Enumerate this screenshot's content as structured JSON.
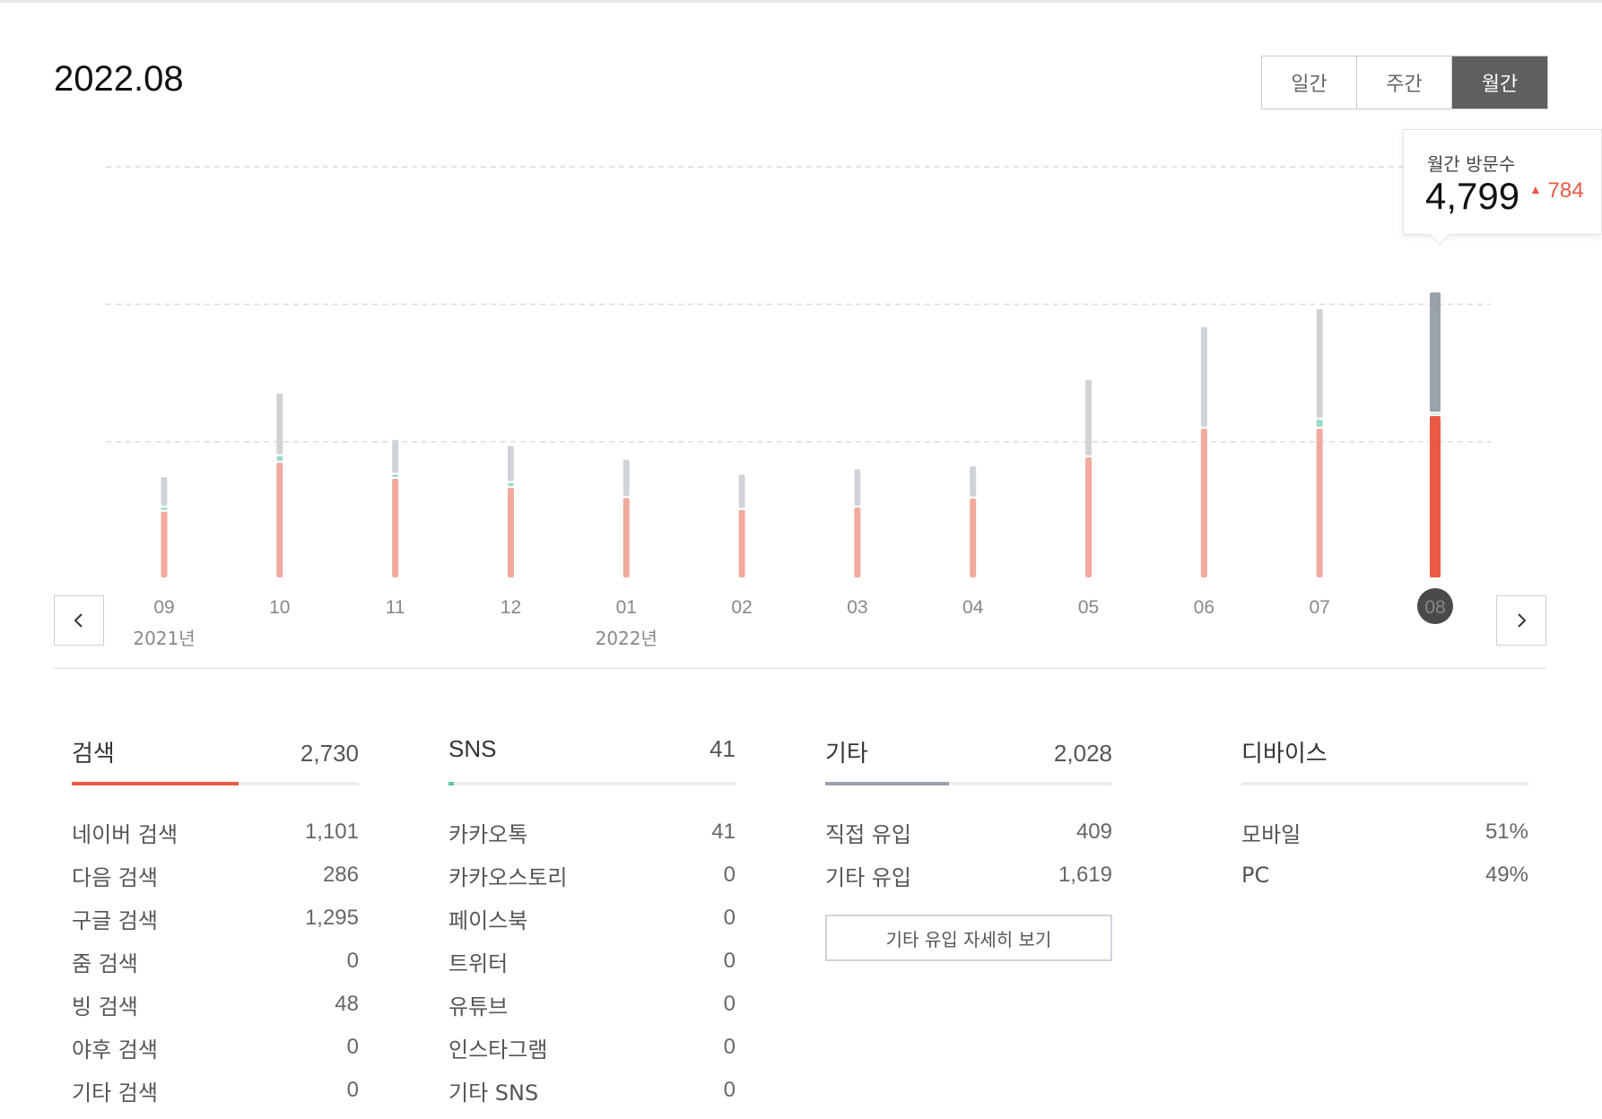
{
  "period": "2022.08",
  "tabs": [
    {
      "label": "일간",
      "active": false
    },
    {
      "label": "주간",
      "active": false
    },
    {
      "label": "월간",
      "active": true
    }
  ],
  "tooltip": {
    "label": "월간 방문수",
    "value": "4,799",
    "delta": "784",
    "delta_color": "#e95a45"
  },
  "colors": {
    "search": "#f2aa9f",
    "search_active": "#e95a45",
    "sns": "#9adbc8",
    "other": "#d0d4d9",
    "other_active": "#9aa2ab",
    "grid": "#dcdcdc",
    "selected_badge": "#4a4a4a"
  },
  "chart_data": {
    "type": "bar",
    "stacked": true,
    "categories": [
      "09",
      "10",
      "11",
      "12",
      "01",
      "02",
      "03",
      "04",
      "05",
      "06",
      "07",
      "08"
    ],
    "year_labels": [
      {
        "category": "09",
        "label": "2021년"
      },
      {
        "category": "01",
        "label": "2022년"
      }
    ],
    "selected_category": "08",
    "series": [
      {
        "key": "search",
        "values": [
          1130,
          1950,
          1680,
          1530,
          1360,
          1160,
          1200,
          1350,
          2040,
          2520,
          2520,
          2730
        ]
      },
      {
        "key": "sns",
        "values": [
          70,
          110,
          70,
          80,
          0,
          0,
          0,
          0,
          0,
          0,
          150,
          41
        ]
      },
      {
        "key": "other",
        "values": [
          510,
          1050,
          580,
          620,
          640,
          590,
          640,
          540,
          1300,
          1700,
          1850,
          2028
        ]
      }
    ],
    "ylim": [
      0,
      6900
    ],
    "gridlines": [
      2300,
      4600,
      6900
    ],
    "grid": true
  },
  "sections": {
    "search": {
      "title": "검색",
      "total": "2,730",
      "share": 0.58,
      "rows": [
        {
          "label": "네이버 검색",
          "value": "1,101"
        },
        {
          "label": "다음 검색",
          "value": "286"
        },
        {
          "label": "구글 검색",
          "value": "1,295"
        },
        {
          "label": "줌 검색",
          "value": "0"
        },
        {
          "label": "빙 검색",
          "value": "48"
        },
        {
          "label": "야후 검색",
          "value": "0"
        },
        {
          "label": "기타 검색",
          "value": "0"
        }
      ]
    },
    "sns": {
      "title": "SNS",
      "total": "41",
      "share": 0.02,
      "rows": [
        {
          "label": "카카오톡",
          "value": "41"
        },
        {
          "label": "카카오스토리",
          "value": "0"
        },
        {
          "label": "페이스북",
          "value": "0"
        },
        {
          "label": "트위터",
          "value": "0"
        },
        {
          "label": "유튜브",
          "value": "0"
        },
        {
          "label": "인스타그램",
          "value": "0"
        },
        {
          "label": "기타 SNS",
          "value": "0"
        }
      ]
    },
    "other": {
      "title": "기타",
      "total": "2,028",
      "share": 0.43,
      "rows": [
        {
          "label": "직접 유입",
          "value": "409"
        },
        {
          "label": "기타 유입",
          "value": "1,619"
        }
      ],
      "detail_button": "기타 유입 자세히 보기"
    },
    "device": {
      "title": "디바이스",
      "rows": [
        {
          "label": "모바일",
          "value": "51%"
        },
        {
          "label": "PC",
          "value": "49%"
        }
      ]
    }
  }
}
